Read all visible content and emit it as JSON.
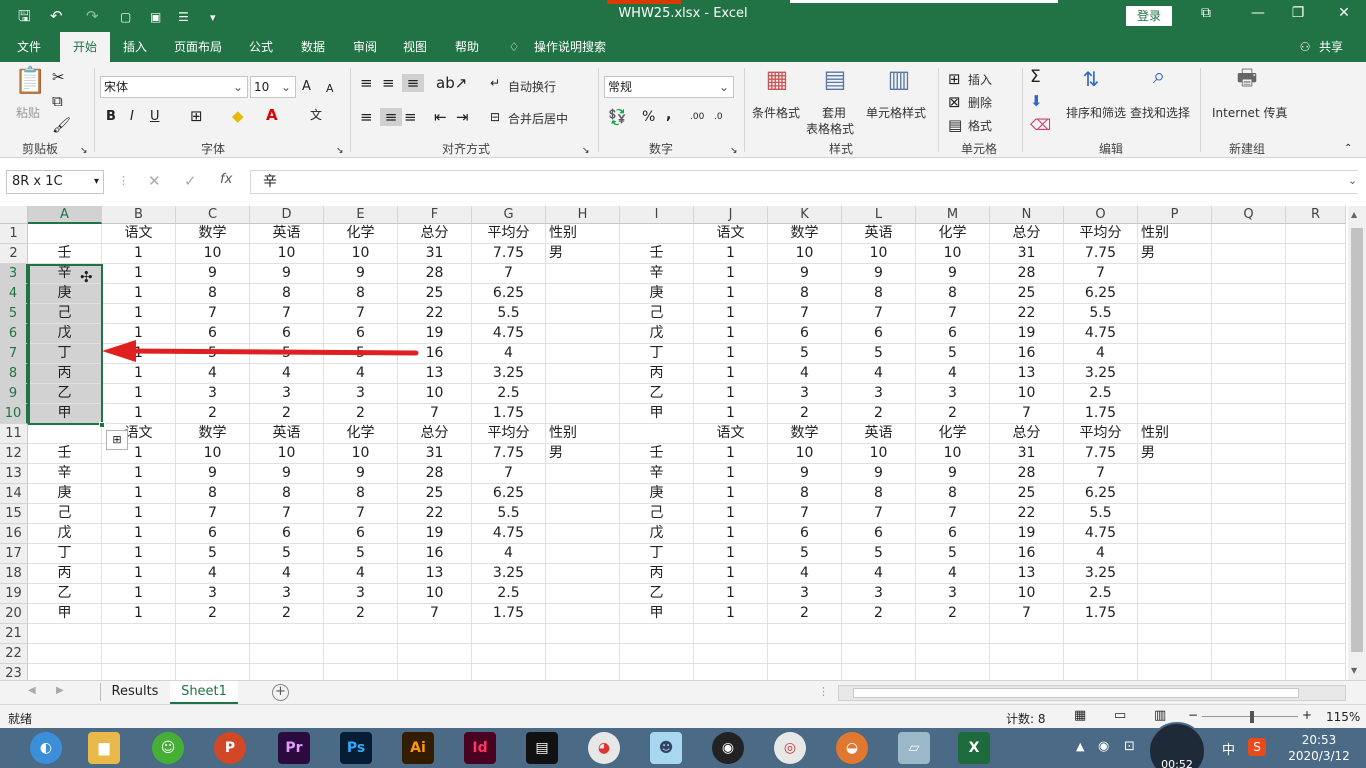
{
  "window": {
    "title": "WHW25.xlsx  -  Excel",
    "login_label": "登录",
    "minimize": "—",
    "restore": "❐",
    "close": "✕",
    "ribbon_display": "⧉",
    "accent_color": "#217346"
  },
  "quick_access": {
    "save": "🖫",
    "undo": "↶",
    "redo": "↷",
    "customize": "▾"
  },
  "menu": {
    "tabs": [
      "文件",
      "开始",
      "插入",
      "页面布局",
      "公式",
      "数据",
      "审阅",
      "视图",
      "帮助"
    ],
    "active": "开始",
    "tell_me": "操作说明搜索",
    "share": "共享"
  },
  "ribbon": {
    "clipboard": {
      "title": "剪贴板",
      "paste": "粘贴"
    },
    "font": {
      "title": "字体",
      "name": "宋体",
      "size": "10",
      "bold": "B",
      "italic": "I",
      "underline": "U",
      "grow": "A",
      "shrink": "A"
    },
    "alignment": {
      "title": "对齐方式",
      "wrap": "自动换行",
      "merge": "合并后居中"
    },
    "number": {
      "title": "数字",
      "format": "常规",
      "percent": "%",
      "comma": ","
    },
    "styles": {
      "title": "样式",
      "conditional": "条件格式",
      "table_format_1": "套用",
      "table_format_2": "表格格式",
      "cell_styles": "单元格样式"
    },
    "cells": {
      "title": "单元格",
      "insert": "插入",
      "delete": "删除",
      "format": "格式"
    },
    "editing": {
      "title": "编辑",
      "sort": "排序和筛选",
      "find": "查找和选择"
    },
    "new_group": {
      "title": "新建组",
      "fax": "Internet 传真"
    }
  },
  "formula_bar": {
    "name_box": "8R x 1C",
    "fx": "fx",
    "value": "辛"
  },
  "grid": {
    "columns": [
      "A",
      "B",
      "C",
      "D",
      "E",
      "F",
      "G",
      "H",
      "I",
      "J",
      "K",
      "L",
      "M",
      "N",
      "O",
      "P",
      "Q",
      "R"
    ],
    "row_numbers": [
      "1",
      "2",
      "3",
      "4",
      "5",
      "6",
      "7",
      "8",
      "9",
      "10",
      "11",
      "12",
      "13",
      "14",
      "15",
      "16",
      "17",
      "18",
      "19",
      "20",
      "21",
      "22",
      "23"
    ],
    "rows": [
      [
        "",
        "语文",
        "数学",
        "英语",
        "化学",
        "总分",
        "平均分",
        "性别",
        "",
        "语文",
        "数学",
        "英语",
        "化学",
        "总分",
        "平均分",
        "性别",
        "",
        ""
      ],
      [
        "壬",
        "1",
        "10",
        "10",
        "10",
        "31",
        "7.75",
        "男",
        "壬",
        "1",
        "10",
        "10",
        "10",
        "31",
        "7.75",
        "男",
        "",
        ""
      ],
      [
        "辛",
        "1",
        "9",
        "9",
        "9",
        "28",
        "7",
        "",
        "辛",
        "1",
        "9",
        "9",
        "9",
        "28",
        "7",
        "",
        "",
        ""
      ],
      [
        "庚",
        "1",
        "8",
        "8",
        "8",
        "25",
        "6.25",
        "",
        "庚",
        "1",
        "8",
        "8",
        "8",
        "25",
        "6.25",
        "",
        "",
        ""
      ],
      [
        "己",
        "1",
        "7",
        "7",
        "7",
        "22",
        "5.5",
        "",
        "己",
        "1",
        "7",
        "7",
        "7",
        "22",
        "5.5",
        "",
        "",
        ""
      ],
      [
        "戊",
        "1",
        "6",
        "6",
        "6",
        "19",
        "4.75",
        "",
        "戊",
        "1",
        "6",
        "6",
        "6",
        "19",
        "4.75",
        "",
        "",
        ""
      ],
      [
        "丁",
        "1",
        "5",
        "5",
        "5",
        "16",
        "4",
        "",
        "丁",
        "1",
        "5",
        "5",
        "5",
        "16",
        "4",
        "",
        "",
        ""
      ],
      [
        "丙",
        "1",
        "4",
        "4",
        "4",
        "13",
        "3.25",
        "",
        "丙",
        "1",
        "4",
        "4",
        "4",
        "13",
        "3.25",
        "",
        "",
        ""
      ],
      [
        "乙",
        "1",
        "3",
        "3",
        "3",
        "10",
        "2.5",
        "",
        "乙",
        "1",
        "3",
        "3",
        "3",
        "10",
        "2.5",
        "",
        "",
        ""
      ],
      [
        "甲",
        "1",
        "2",
        "2",
        "2",
        "7",
        "1.75",
        "",
        "甲",
        "1",
        "2",
        "2",
        "2",
        "7",
        "1.75",
        "",
        "",
        ""
      ],
      [
        "",
        "语文",
        "数学",
        "英语",
        "化学",
        "总分",
        "平均分",
        "性别",
        "",
        "语文",
        "数学",
        "英语",
        "化学",
        "总分",
        "平均分",
        "性别",
        "",
        ""
      ],
      [
        "壬",
        "1",
        "10",
        "10",
        "10",
        "31",
        "7.75",
        "男",
        "壬",
        "1",
        "10",
        "10",
        "10",
        "31",
        "7.75",
        "男",
        "",
        ""
      ],
      [
        "辛",
        "1",
        "9",
        "9",
        "9",
        "28",
        "7",
        "",
        "辛",
        "1",
        "9",
        "9",
        "9",
        "28",
        "7",
        "",
        "",
        ""
      ],
      [
        "庚",
        "1",
        "8",
        "8",
        "8",
        "25",
        "6.25",
        "",
        "庚",
        "1",
        "8",
        "8",
        "8",
        "25",
        "6.25",
        "",
        "",
        ""
      ],
      [
        "己",
        "1",
        "7",
        "7",
        "7",
        "22",
        "5.5",
        "",
        "己",
        "1",
        "7",
        "7",
        "7",
        "22",
        "5.5",
        "",
        "",
        ""
      ],
      [
        "戊",
        "1",
        "6",
        "6",
        "6",
        "19",
        "4.75",
        "",
        "戊",
        "1",
        "6",
        "6",
        "6",
        "19",
        "4.75",
        "",
        "",
        ""
      ],
      [
        "丁",
        "1",
        "5",
        "5",
        "5",
        "16",
        "4",
        "",
        "丁",
        "1",
        "5",
        "5",
        "5",
        "16",
        "4",
        "",
        "",
        ""
      ],
      [
        "丙",
        "1",
        "4",
        "4",
        "4",
        "13",
        "3.25",
        "",
        "丙",
        "1",
        "4",
        "4",
        "4",
        "13",
        "3.25",
        "",
        "",
        ""
      ],
      [
        "乙",
        "1",
        "3",
        "3",
        "3",
        "10",
        "2.5",
        "",
        "乙",
        "1",
        "3",
        "3",
        "3",
        "10",
        "2.5",
        "",
        "",
        ""
      ],
      [
        "甲",
        "1",
        "2",
        "2",
        "2",
        "7",
        "1.75",
        "",
        "甲",
        "1",
        "2",
        "2",
        "2",
        "7",
        "1.75",
        "",
        "",
        ""
      ],
      [
        "",
        "",
        "",
        "",
        "",
        "",
        "",
        "",
        "",
        "",
        "",
        "",
        "",
        "",
        "",
        "",
        "",
        ""
      ],
      [
        "",
        "",
        "",
        "",
        "",
        "",
        "",
        "",
        "",
        "",
        "",
        "",
        "",
        "",
        "",
        "",
        "",
        ""
      ],
      [
        "",
        "",
        "",
        "",
        "",
        "",
        "",
        "",
        "",
        "",
        "",
        "",
        "",
        "",
        "",
        "",
        "",
        ""
      ]
    ],
    "selection": "A3:A10",
    "arrow_color": "#e02020"
  },
  "sheets": {
    "tabs": [
      "Results",
      "Sheet1"
    ],
    "active": "Sheet1",
    "add": "+"
  },
  "status": {
    "ready": "就绪",
    "count": "计数: 8",
    "zoom": "115%",
    "zoom_out": "−",
    "zoom_in": "+"
  },
  "taskbar": {
    "apps": [
      "Pr",
      "Ps",
      "Ai",
      "Id",
      "X"
    ],
    "tray_ime": "中",
    "time": "20:53",
    "date": "2020/3/12",
    "recording_timer": "00:52"
  }
}
